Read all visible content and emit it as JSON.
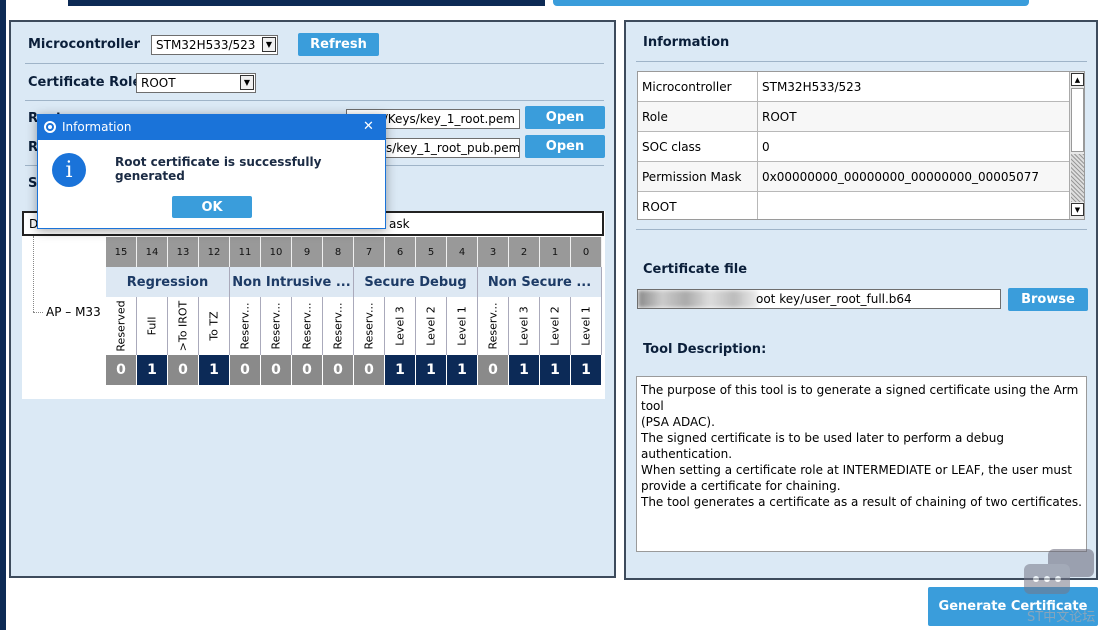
{
  "top": {},
  "left": {
    "mcu_label": "Microcontroller",
    "mcu_value": "STM32H533/523",
    "refresh_label": "Refresh",
    "role_label": "Certificate Role",
    "role_value": "ROOT",
    "root_key_label": "Root",
    "root_key_path": "…/Keys/key_1_root.pem",
    "root_pub_label": "R",
    "root_pub_path": "s/key_1_root_pub.pem",
    "open_label": "Open",
    "section_stub": "Se",
    "perm_header_d": "D",
    "perm_header_mask": "ask",
    "tree_node": "AP – M33",
    "bit_numbers": [
      "15",
      "14",
      "13",
      "12",
      "11",
      "10",
      "9",
      "8",
      "7",
      "6",
      "5",
      "4",
      "3",
      "2",
      "1",
      "0"
    ],
    "groups": [
      "Regression",
      "Non Intrusive ...",
      "Secure Debug",
      "Non Secure ..."
    ],
    "bit_labels": [
      "Reserved",
      "Full",
      ">To IROT",
      "To TZ",
      "Reserv...",
      "Reserv...",
      "Reserv...",
      "Reserv...",
      "Reserv...",
      "Level 3",
      "Level 2",
      "Level 1",
      "Reserv...",
      "Level 3",
      "Level 2",
      "Level 1"
    ],
    "bit_values": [
      "0",
      "1",
      "0",
      "1",
      "0",
      "0",
      "0",
      "0",
      "0",
      "1",
      "1",
      "1",
      "0",
      "1",
      "1",
      "1"
    ]
  },
  "right": {
    "info_title": "Information",
    "rows": [
      {
        "key": "Microcontroller",
        "value": "STM32H533/523"
      },
      {
        "key": "Role",
        "value": "ROOT"
      },
      {
        "key": "SOC class",
        "value": "0"
      },
      {
        "key": "Permission Mask",
        "value": "0x00000000_00000000_00000000_00005077"
      },
      {
        "key": "ROOT",
        "value": ""
      }
    ],
    "cert_file_label": "Certificate file",
    "cert_file_path": "oot key/user_root_full.b64",
    "browse_label": "Browse",
    "tool_desc_label": "Tool Description:",
    "tool_desc_lines": [
      "The purpose of this tool is to generate a signed certificate using the Arm tool",
      "(PSA ADAC).",
      "The signed certificate is to be used later to perform a debug authentication.",
      "When setting a certificate role at INTERMEDIATE or LEAF, the user must",
      "provide a certificate for chaining.",
      "The tool generates a certificate as a result of chaining of two certificates."
    ]
  },
  "generate_label": "Generate Certificate",
  "watermark": "ST中文论坛",
  "dialog": {
    "title": "Information",
    "close": "✕",
    "message": "Root certificate is successfully generated",
    "ok_label": "OK",
    "info_glyph": "i"
  },
  "colors": {
    "accent": "#3a9ddb",
    "bit_one": "#0c2a57",
    "bit_zero": "#8a8a8a",
    "dialog_titlebar": "#1a73d9",
    "panel_bg": "#dbe9f5"
  }
}
